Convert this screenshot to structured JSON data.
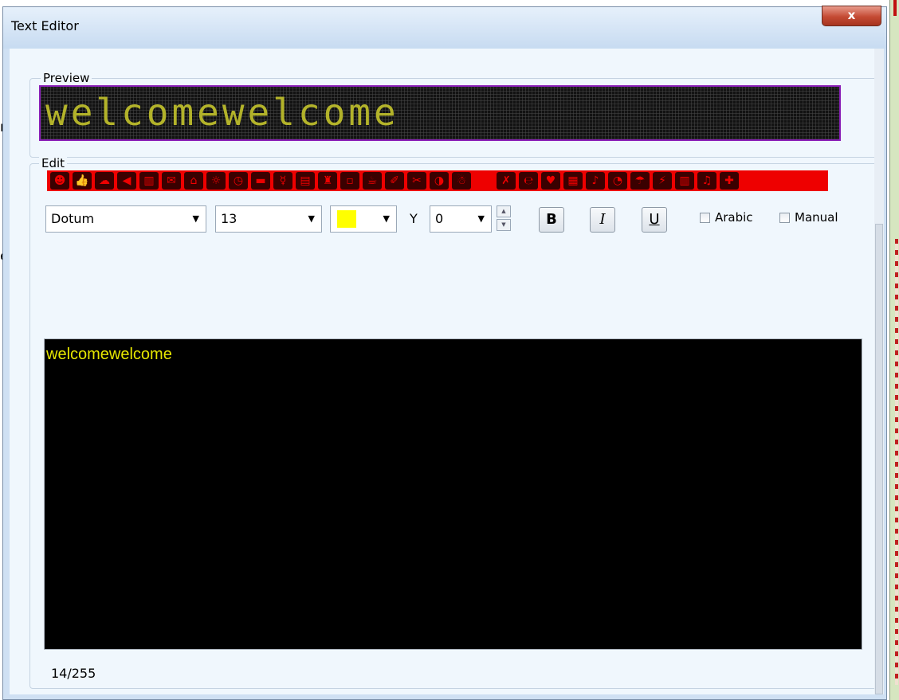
{
  "background": {
    "fragment_1": "nt",
    "fragment_2": "es"
  },
  "window": {
    "title": "Text Editor",
    "close_label": "x"
  },
  "preview": {
    "group_label": "Preview",
    "display_text": "welcomewelcome",
    "led_color": "#b3b32a",
    "border_color": "#8a1fb8"
  },
  "edit": {
    "group_label": "Edit",
    "symbols_bar_color": "#ee0000",
    "symbols": [
      "☻",
      "👍",
      "☁",
      "◀",
      "▥",
      "✉",
      "⌂",
      "☼",
      "◷",
      "▬",
      "☿",
      "▤",
      "♜",
      "▫",
      "☕",
      "✐",
      "✂",
      "◑",
      "☃",
      "",
      "✗",
      "℮",
      "♥",
      "▦",
      "♪",
      "◔",
      "☂",
      "⚡",
      "▥",
      "♫",
      "✚"
    ],
    "font": "Dotum",
    "size": "13",
    "color_swatch": "#ffff00",
    "y_label": "Y",
    "y_value": "0",
    "bold_label": "B",
    "italic_label": "I",
    "underline_label": "U",
    "arabic_label": "Arabic",
    "manual_label": "Manual",
    "text": "welcomewelcome",
    "text_color": "#e6e600",
    "counter": "14/255"
  }
}
